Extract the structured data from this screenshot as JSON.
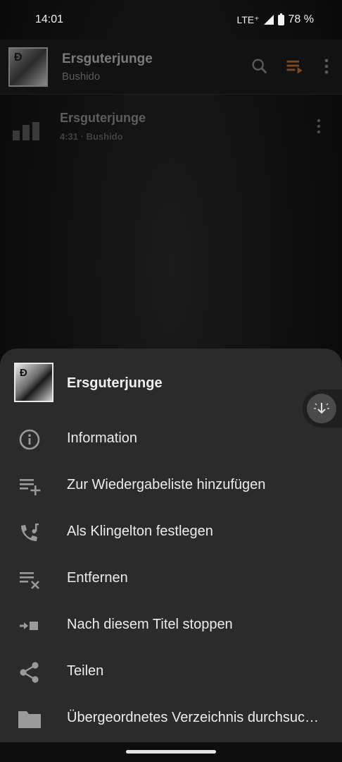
{
  "status_bar": {
    "time": "14:01",
    "network": "LTE⁺",
    "battery": "78 %"
  },
  "toolbar": {
    "title": "Ersguterjunge",
    "subtitle": "Bushido",
    "icons": [
      "search-icon",
      "queue-icon",
      "more-vert-icon"
    ],
    "accent": "#c96a2a"
  },
  "song": {
    "title": "Ersguterjunge",
    "meta": "4:31 · Bushido"
  },
  "sheet": {
    "title": "Ersguterjunge",
    "items": [
      {
        "label": "Information",
        "icon": "info-icon"
      },
      {
        "label": "Zur Wiedergabeliste hinzufügen",
        "icon": "playlist-add-icon"
      },
      {
        "label": "Als Klingelton festlegen",
        "icon": "ringtone-icon"
      },
      {
        "label": "Entfernen",
        "icon": "playlist-remove-icon"
      },
      {
        "label": "Nach diesem Titel stoppen",
        "icon": "stop-after-icon"
      },
      {
        "label": "Teilen",
        "icon": "share-icon"
      },
      {
        "label": "Übergeordnetes Verzeichnis durchsuc…",
        "icon": "folder-icon"
      }
    ]
  }
}
